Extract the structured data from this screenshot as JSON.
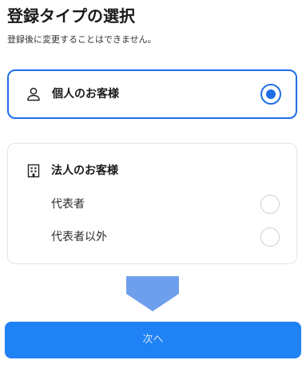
{
  "page": {
    "title": "登録タイプの選択",
    "subtitle": "登録後に変更することはできません。"
  },
  "individual": {
    "label": "個人のお客様",
    "icon": "person-icon",
    "selected": true
  },
  "corporate": {
    "label": "法人のお客様",
    "icon": "building-icon",
    "options": [
      {
        "label": "代表者",
        "selected": false
      },
      {
        "label": "代表者以外",
        "selected": false
      }
    ]
  },
  "actions": {
    "next_label": "次へ"
  },
  "colors": {
    "accent": "#1f6fe6",
    "button": "#1f82f5",
    "arrow": "#6e9fec",
    "border_muted": "#e4e4e4"
  }
}
